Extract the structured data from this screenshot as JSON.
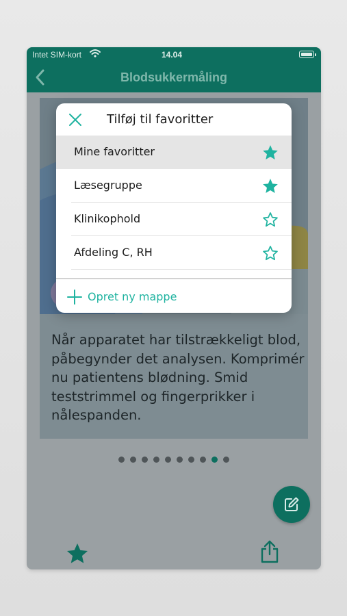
{
  "status_bar": {
    "carrier": "Intet SIM-kort",
    "time": "14.04"
  },
  "nav": {
    "title": "Blodsukkermåling"
  },
  "content": {
    "text": "Når apparatet har tilstrækkeligt blod, påbegynder det analysen. Komprimér nu patientens blødning. Smid teststrimmel og fingerprikker i nålespanden."
  },
  "pagination": {
    "total": 10,
    "active_index": 8
  },
  "modal": {
    "title": "Tilføj til favoritter",
    "items": [
      {
        "label": "Mine favoritter",
        "starred": true,
        "selected": true
      },
      {
        "label": "Læsegruppe",
        "starred": true,
        "selected": false
      },
      {
        "label": "Klinikophold",
        "starred": false,
        "selected": false
      },
      {
        "label": "Afdeling C, RH",
        "starred": false,
        "selected": false
      }
    ],
    "new_folder_label": "Opret ny mappe"
  },
  "icons": {
    "back": "chevron-left-icon",
    "close": "close-icon",
    "star_filled": "star-filled-icon",
    "star_outline": "star-outline-icon",
    "plus": "plus-icon",
    "edit": "edit-icon",
    "share": "share-icon"
  },
  "colors": {
    "primary": "#0d6f5f",
    "accent": "#1fb3a0",
    "overlay": "#9aa0a3"
  }
}
